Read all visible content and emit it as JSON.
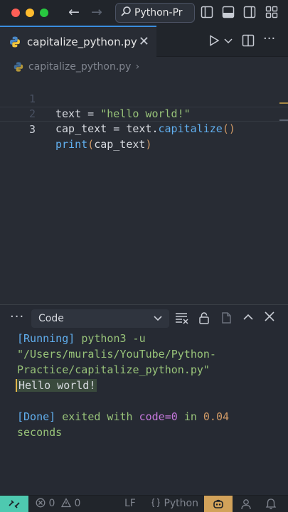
{
  "titlebar": {
    "command_center_label": "Python-Pr",
    "icons": [
      "back-arrow-icon",
      "forward-arrow-icon",
      "search-icon",
      "toggle-sidebar-icon",
      "toggle-panel-icon",
      "toggle-secondary-sidebar-icon",
      "customize-layout-icon"
    ]
  },
  "tab": {
    "label": "capitalize_python.py",
    "close_glyph": "✕"
  },
  "breadcrumb": {
    "file": "capitalize_python.py",
    "chevron": "›"
  },
  "editor": {
    "lines": [
      {
        "num": "1",
        "current": false
      },
      {
        "num": "2",
        "current": false
      },
      {
        "num": "3",
        "current": true
      }
    ]
  },
  "panel": {
    "more": "···",
    "output_channel": "Code",
    "output": {
      "running_tag": "[Running]",
      "command": "python3 -u \"/Users/muralis/YouTube/Python-Practice/capitalize_python.py\"",
      "result": "Hello world!",
      "done_tag": "[Done]",
      "exited_with": "exited with",
      "code_label": "code=0",
      "in_label": "in",
      "duration": "0.04",
      "seconds_label": "seconds"
    }
  },
  "statusbar": {
    "errors": "0",
    "warnings": "0",
    "line_ending": "LF",
    "language": "Python"
  },
  "colors": {
    "accent": "#3a8dde",
    "remote": "#4ec9b0",
    "copilot": "#d2a25a"
  }
}
